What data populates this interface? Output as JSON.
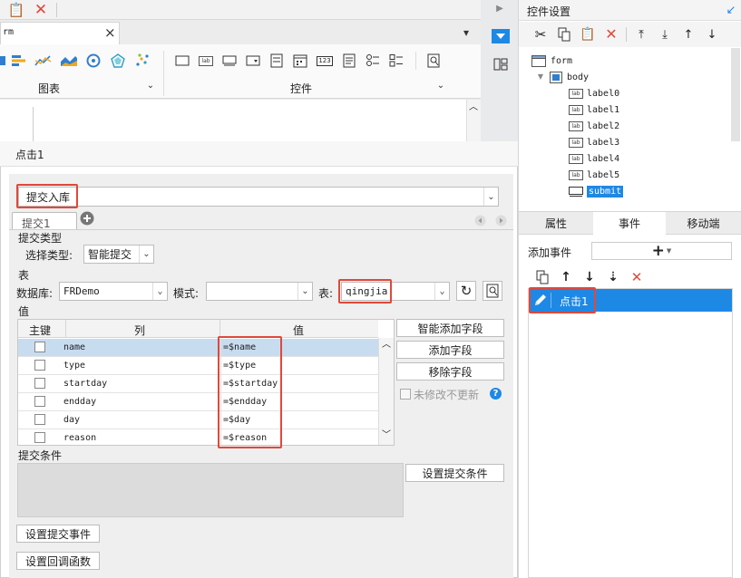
{
  "window": {
    "form_tab_label": "rm",
    "close_glyph": "×"
  },
  "toolbar": {
    "chart_group_label": "图表",
    "controls_group_label": "控件",
    "lab_text": "lab",
    "num_text": "123"
  },
  "dialog": {
    "title": "点击1",
    "event_type": "提交入库",
    "subtab": "提交1",
    "submit_type_section": "提交类型",
    "select_type_label": "选择类型:",
    "select_type_value": "智能提交",
    "table_section": "表",
    "database_label": "数据库:",
    "database_value": "FRDemo",
    "mode_label": "模式:",
    "mode_value": "",
    "table_label": "表:",
    "table_value": "qingjia",
    "value_section": "值",
    "columns": {
      "pk": "主键",
      "col": "列",
      "val": "值"
    },
    "rows": [
      {
        "col": "name",
        "val": "=$name"
      },
      {
        "col": "type",
        "val": "=$type"
      },
      {
        "col": "startday",
        "val": "=$startday"
      },
      {
        "col": "endday",
        "val": "=$endday"
      },
      {
        "col": "day",
        "val": "=$day"
      },
      {
        "col": "reason",
        "val": "=$reason"
      }
    ],
    "smart_add_fields_button": "智能添加字段",
    "add_field_button": "添加字段",
    "remove_field_button": "移除字段",
    "unmodified_no_update_label": "未修改不更新",
    "help_glyph": "?",
    "submit_condition_section": "提交条件",
    "set_submit_condition_button": "设置提交条件",
    "set_submit_event_button": "设置提交事件",
    "set_callback_button": "设置回调函数"
  },
  "right_panel": {
    "title": "控件设置",
    "tree": {
      "lab_icon_text": "lab",
      "root": "form",
      "body": "body",
      "items": [
        "label0",
        "label1",
        "label2",
        "label3",
        "label4",
        "label5"
      ],
      "selected": "submit"
    },
    "tabs": [
      "属性",
      "事件",
      "移动端"
    ],
    "add_event_label": "添加事件",
    "add_glyph": "+",
    "event_item": "点击1"
  },
  "colors": {
    "accent": "#1e88e5",
    "highlight": "#e0483a",
    "selected_row": "#c8dcf0"
  }
}
